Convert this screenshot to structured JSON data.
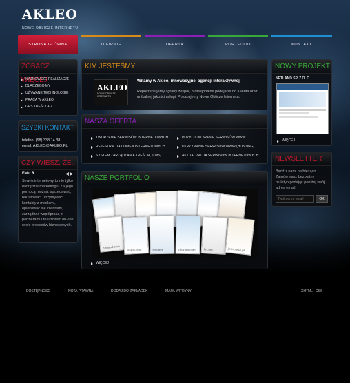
{
  "brand": {
    "logo": "AKLEO",
    "tagline": "NOWE OBLICZE INTERNETU"
  },
  "nav": [
    {
      "label": "STRONA GŁÓWNA",
      "color": "#c0162f"
    },
    {
      "label": "O FIRMIE",
      "color": "#d58a1a"
    },
    {
      "label": "OFERTA",
      "color": "#8b1fb8"
    },
    {
      "label": "PORTFOLIO",
      "color": "#38a838"
    },
    {
      "label": "KONTAKT",
      "color": "#1f8fd1"
    }
  ],
  "left": {
    "see_more": {
      "title": "ZOBACZ WIĘCEJ",
      "items": [
        "NAJNOWSZE REALIZACJE",
        "DLACZEGO MY",
        "UŻYWANE TECHNOLOGIE",
        "PRACA W AKLEO",
        "GPS TREŚCI A-Z"
      ]
    },
    "contact": {
      "title": "SZYBKI KONTAKT",
      "phone": "telefon: (58) 333 14 38",
      "email": "email: AKLEO@AKLEO.PL"
    },
    "facts": {
      "title": "CZY WIESZ, ŻE...",
      "label": "Fakt 6.",
      "text": "Serwis internetowy to nie tylko narzędzie marketingu. Za jego pomocą można: sprzedawać, rekrutować, utrzymywać kontakty z mediami, opiekować się klientami, zarządzać współpracą z partnerami i realizować on-line wiele procesów biznesowych."
    }
  },
  "center": {
    "about": {
      "title": "KIM JESTEŚMY",
      "logo": "AKLEO",
      "logo_sub": "NOWE OBLICZE INTERNETU",
      "headline": "Witamy w Akleo, innowacyjnej agencji interaktywnej.",
      "text": "Reprezentujemy zgrany zespół, profesjonalne podejście do Klienta oraz unikalnej jakości usługi. Pokazujemy Nowe Oblicze Internetu."
    },
    "offer": {
      "title": "NASZA OFERTA",
      "items": [
        "TWORZENIE SERWISÓW INTERNETOWYCH",
        "POZYCJONOWANIE SERWISÓW WWW",
        "REJESTRACJA DOMEN INTERNETOWYCH",
        "UTRZYMANIE SERWISÓW WWW (HOSTING)",
        "SYSTEM ZARZĄDZANIA TREŚCIĄ (CMS)",
        "AKTUALIZACJA SERWISÓW INTERNETOWYCH"
      ]
    },
    "portfolio": {
      "title": "NASZE PORTFOLIO",
      "captions": [
        "netland.com",
        "zlepty.com",
        "mis.net",
        "chorom.com",
        "lyt.net",
        "jotin.gola.pl"
      ],
      "more": "WIĘCEJ"
    }
  },
  "right": {
    "project": {
      "title": "NOWY PROJEKT",
      "client": "NETLAND SP. Z O. O.",
      "more": "WIĘCEJ"
    },
    "newsletter": {
      "title": "NEWSLETTER",
      "text": "Bądź z nami na bieżąco. Zamów nasz bezpłatny biuletyn podając poniżej swój adres email.",
      "placeholder": "Twój adres email",
      "button": "OK"
    }
  },
  "footer": {
    "links": [
      "DOSTĘPNOŚĆ",
      "NOTA PRAWNA",
      "DODAJ DO ZAKŁADEK",
      "MAPA WITRYNY"
    ],
    "xhtml": "XHTML",
    "css": "CSS"
  }
}
